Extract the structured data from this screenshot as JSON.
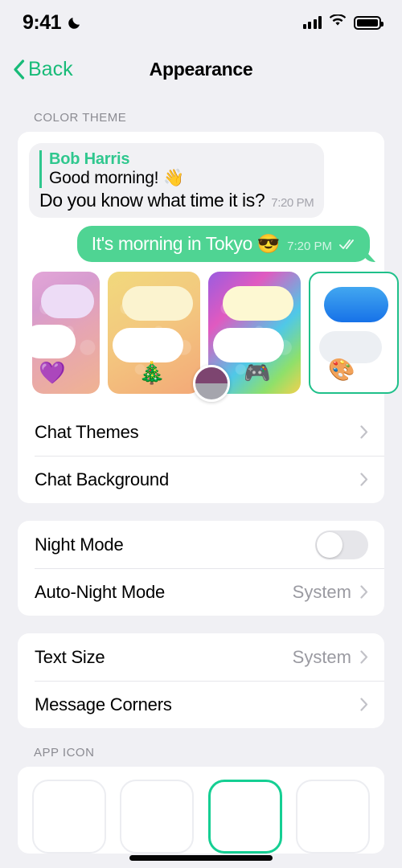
{
  "status_bar": {
    "time": "9:41",
    "dnd_icon": "moon-icon",
    "signal_icon": "cellular-bars-icon",
    "wifi_icon": "wifi-icon",
    "battery_icon": "battery-full-icon"
  },
  "nav": {
    "back_label": "Back",
    "back_icon": "chevron-left-icon",
    "title": "Appearance"
  },
  "color_theme": {
    "header": "COLOR THEME",
    "preview": {
      "quote_name": "Bob Harris",
      "quote_text": "Good morning! 👋",
      "incoming_text": "Do you know what time it is?",
      "incoming_time": "7:20 PM",
      "outgoing_text": "It's morning in Tokyo 😎",
      "outgoing_time": "7:20 PM",
      "read_icon": "double-check-icon"
    },
    "swatches": [
      {
        "name": "heart-theme",
        "emoji": "💜",
        "selected": false
      },
      {
        "name": "christmas-theme",
        "emoji": "🎄",
        "selected": false
      },
      {
        "name": "gaming-theme",
        "emoji": "🎮",
        "selected": false
      },
      {
        "name": "default-theme",
        "emoji": "🎨",
        "selected": true
      }
    ],
    "rows": [
      {
        "label": "Chat Themes",
        "value": "",
        "chevron": true
      },
      {
        "label": "Chat Background",
        "value": "",
        "chevron": true
      }
    ]
  },
  "night_section": {
    "rows": [
      {
        "label": "Night Mode",
        "value": "",
        "toggle": false
      },
      {
        "label": "Auto-Night Mode",
        "value": "System",
        "chevron": true
      }
    ]
  },
  "text_section": {
    "rows": [
      {
        "label": "Text Size",
        "value": "System",
        "chevron": true
      },
      {
        "label": "Message Corners",
        "value": "",
        "chevron": true
      }
    ]
  },
  "app_icon": {
    "header": "APP ICON",
    "tiles": [
      {
        "name": "app-icon-option-1",
        "selected": false
      },
      {
        "name": "app-icon-option-2",
        "selected": false
      },
      {
        "name": "app-icon-option-3",
        "selected": true
      },
      {
        "name": "app-icon-option-4",
        "selected": false
      }
    ]
  },
  "colors": {
    "accent": "#18bb78",
    "outgoing_bubble": "#4fd493",
    "incoming_bubble": "#f1f1f4",
    "page_background": "#f0f0f4",
    "selection_border": "#1fc08a"
  }
}
